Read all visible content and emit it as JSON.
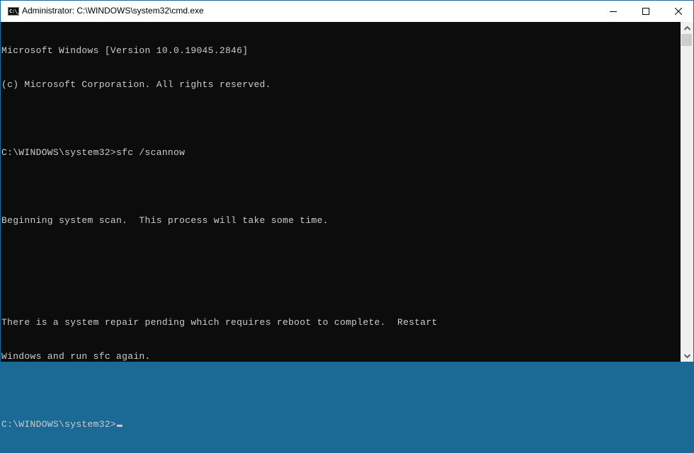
{
  "window": {
    "title": "Administrator: C:\\WINDOWS\\system32\\cmd.exe",
    "app_icon": "cmd-icon",
    "app_icon_text": "C:\\_",
    "controls": {
      "minimize": "minimize-icon",
      "maximize": "maximize-icon",
      "close": "close-icon"
    }
  },
  "console": {
    "lines": [
      "Microsoft Windows [Version 10.0.19045.2846]",
      "(c) Microsoft Corporation. All rights reserved.",
      "",
      "C:\\WINDOWS\\system32>sfc /scannow",
      "",
      "Beginning system scan.  This process will take some time.",
      "",
      "",
      "There is a system repair pending which requires reboot to complete.  Restart",
      "Windows and run sfc again.",
      "",
      "C:\\WINDOWS\\system32>"
    ],
    "colors": {
      "background": "#0c0c0c",
      "foreground": "#cccccc"
    }
  },
  "scrollbar": {
    "up_icon": "chevron-up-icon",
    "down_icon": "chevron-down-icon"
  }
}
